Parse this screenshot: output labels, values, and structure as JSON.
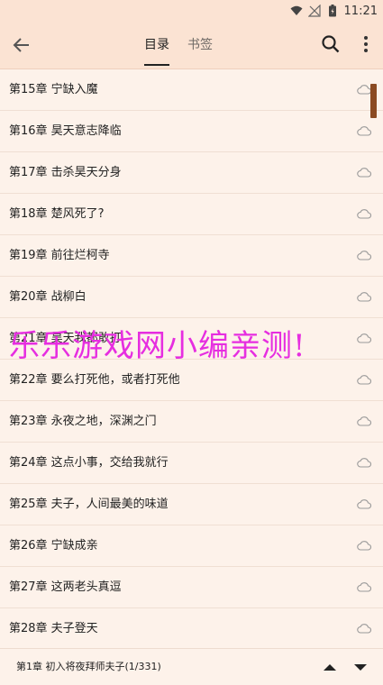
{
  "status_bar": {
    "time": "11:21"
  },
  "toolbar": {
    "tabs": [
      {
        "label": "目录",
        "active": true
      },
      {
        "label": "书签",
        "active": false
      }
    ]
  },
  "chapters": [
    "第15章 宁缺入魔",
    "第16章 昊天意志降临",
    "第17章 击杀昊天分身",
    "第18章 楚风死了?",
    "第19章 前往烂柯寺",
    "第20章 战柳白",
    "第21章 昊天我都敢打",
    "第22章 要么打死他，或者打死他",
    "第23章 永夜之地，深渊之门",
    "第24章 这点小事，交给我就行",
    "第25章 夫子，人间最美的味道",
    "第26章 宁缺成亲",
    "第27章 这两老头真逗",
    "第28章 夫子登天"
  ],
  "watermark": "乐乐游戏网小编亲测!",
  "footer": {
    "current": "第1章 初入将夜拜师夫子(1/331)"
  },
  "colors": {
    "accent": "#8b4a22",
    "header_bg": "#fbe3d3",
    "page_bg": "#fdf2ea",
    "watermark": "#e62ee0"
  }
}
